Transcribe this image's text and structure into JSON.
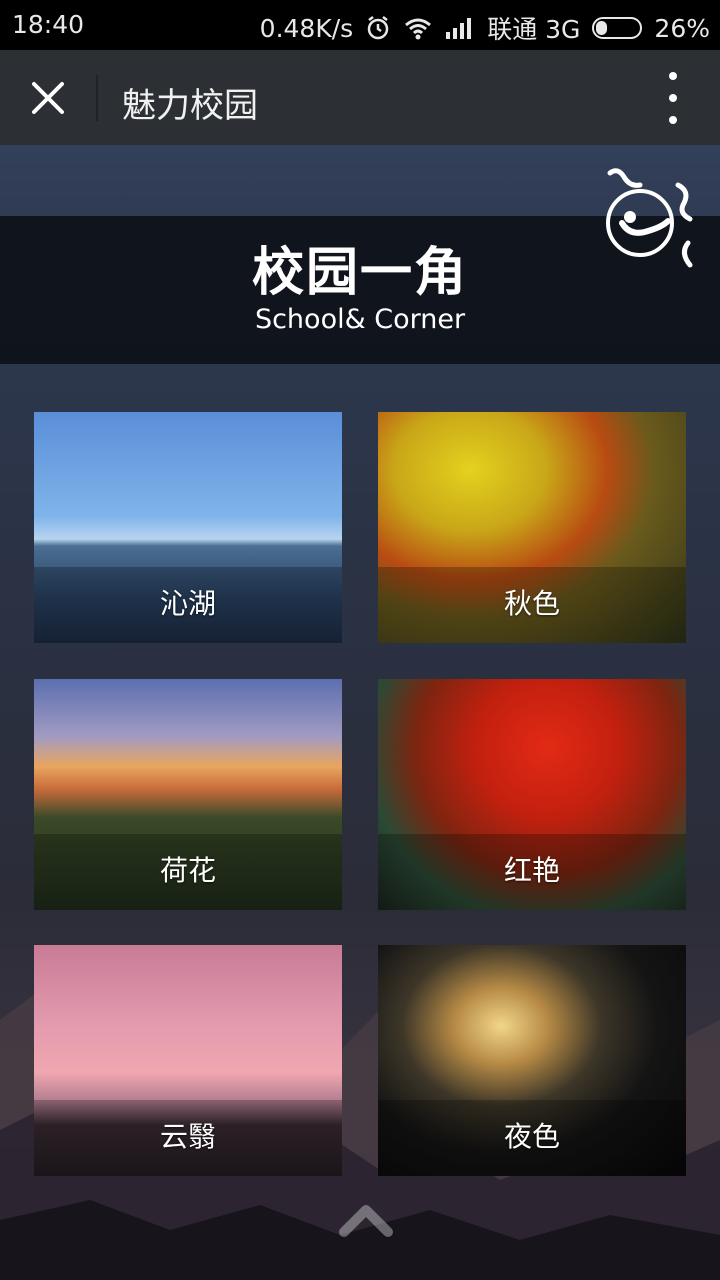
{
  "status_bar": {
    "time": "18:40",
    "speed": "0.48K/s",
    "carrier": "联通 3G",
    "battery": "26%",
    "battery_level": 0.26,
    "icons": [
      "alarm-icon",
      "wifi-icon",
      "signal-icon",
      "battery-icon"
    ]
  },
  "app_bar": {
    "title": "魅力校园",
    "close_icon": "close-icon",
    "menu_icon": "more-vertical-icon"
  },
  "banner": {
    "title": "校园一角",
    "subtitle": "School& Corner",
    "music_icon": "music-icon"
  },
  "gallery": {
    "items": [
      {
        "label": "沁湖"
      },
      {
        "label": "秋色"
      },
      {
        "label": "荷花"
      },
      {
        "label": "红艳"
      },
      {
        "label": "云翳"
      },
      {
        "label": "夜色"
      }
    ]
  },
  "footer": {
    "scroll_icon": "chevron-up-icon"
  }
}
